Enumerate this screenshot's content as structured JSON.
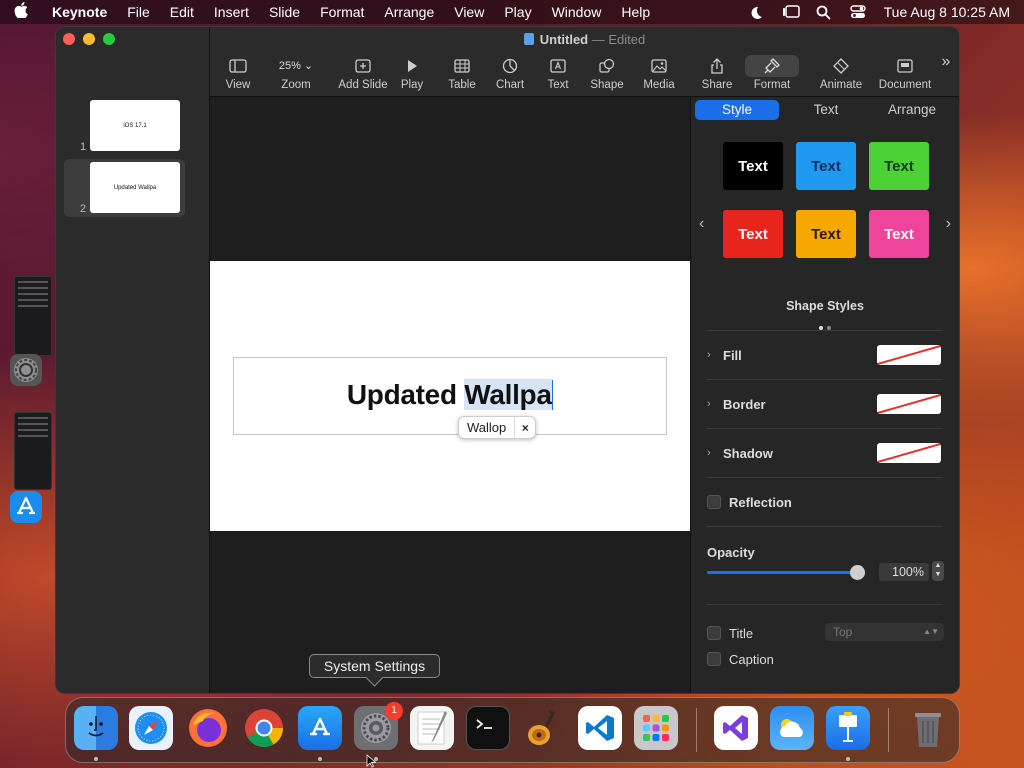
{
  "menubar": {
    "app_name": "Keynote",
    "items": [
      "File",
      "Edit",
      "Insert",
      "Slide",
      "Format",
      "Arrange",
      "View",
      "Play",
      "Window",
      "Help"
    ],
    "clock": "Tue Aug 8  10:25 AM"
  },
  "window": {
    "title": "Untitled",
    "title_sep": "—",
    "title_state": "Edited"
  },
  "toolbar": {
    "zoom_value": "25%",
    "tools": [
      {
        "label": "View",
        "icon": "sidebar-icon"
      },
      {
        "label": "Zoom",
        "icon": "zoom-icon"
      },
      {
        "label": "Add Slide",
        "icon": "add-slide-icon"
      },
      {
        "label": "Play",
        "icon": "play-icon"
      },
      {
        "label": "Table",
        "icon": "table-icon"
      },
      {
        "label": "Chart",
        "icon": "chart-icon"
      },
      {
        "label": "Text",
        "icon": "text-icon"
      },
      {
        "label": "Shape",
        "icon": "shape-icon"
      },
      {
        "label": "Media",
        "icon": "media-icon"
      },
      {
        "label": "Share",
        "icon": "share-icon"
      },
      {
        "label": "Format",
        "icon": "format-icon"
      },
      {
        "label": "Animate",
        "icon": "animate-icon"
      },
      {
        "label": "Document",
        "icon": "document-icon"
      }
    ]
  },
  "navigator": {
    "slides": [
      {
        "number": "1",
        "text": "iOS 17.1"
      },
      {
        "number": "2",
        "text": "Updated Wallpa"
      }
    ]
  },
  "slide": {
    "text_plain": "Updated ",
    "text_selected": "Wallpa",
    "autocorrect_word": "Wallop",
    "autocorrect_dismiss": "×"
  },
  "inspector": {
    "tabs": [
      "Style",
      "Text",
      "Arrange"
    ],
    "style_buttons": [
      {
        "label": "Text",
        "bg": "#000000",
        "fg": "#ffffff"
      },
      {
        "label": "Text",
        "bg": "#1e9bf0",
        "fg": "#0b2a55"
      },
      {
        "label": "Text",
        "bg": "#4cd137",
        "fg": "#0f3a10"
      },
      {
        "label": "Text",
        "bg": "#e8251c",
        "fg": "#ffffff"
      },
      {
        "label": "Text",
        "bg": "#f5a800",
        "fg": "#2a1a00"
      },
      {
        "label": "Text",
        "bg": "#f0449c",
        "fg": "#ffffff"
      }
    ],
    "shape_styles_label": "Shape Styles",
    "fill_label": "Fill",
    "border_label": "Border",
    "shadow_label": "Shadow",
    "reflection_label": "Reflection",
    "opacity_label": "Opacity",
    "opacity_value": "100%",
    "opacity_fraction": 1.0,
    "title_label": "Title",
    "caption_label": "Caption",
    "title_position": "Top"
  },
  "tooltip": "System Settings",
  "dock": {
    "apps": [
      "Finder",
      "Safari",
      "Firefox",
      "Chrome",
      "App Store",
      "System Settings",
      "TextEdit",
      "Terminal",
      "GarageBand",
      "Visual Studio Code",
      "Launchpad",
      "Visual Studio",
      "Weather",
      "Keynote",
      "Trash"
    ],
    "settings_badge": "1"
  },
  "colors": {
    "accent": "#1a6ee8"
  }
}
